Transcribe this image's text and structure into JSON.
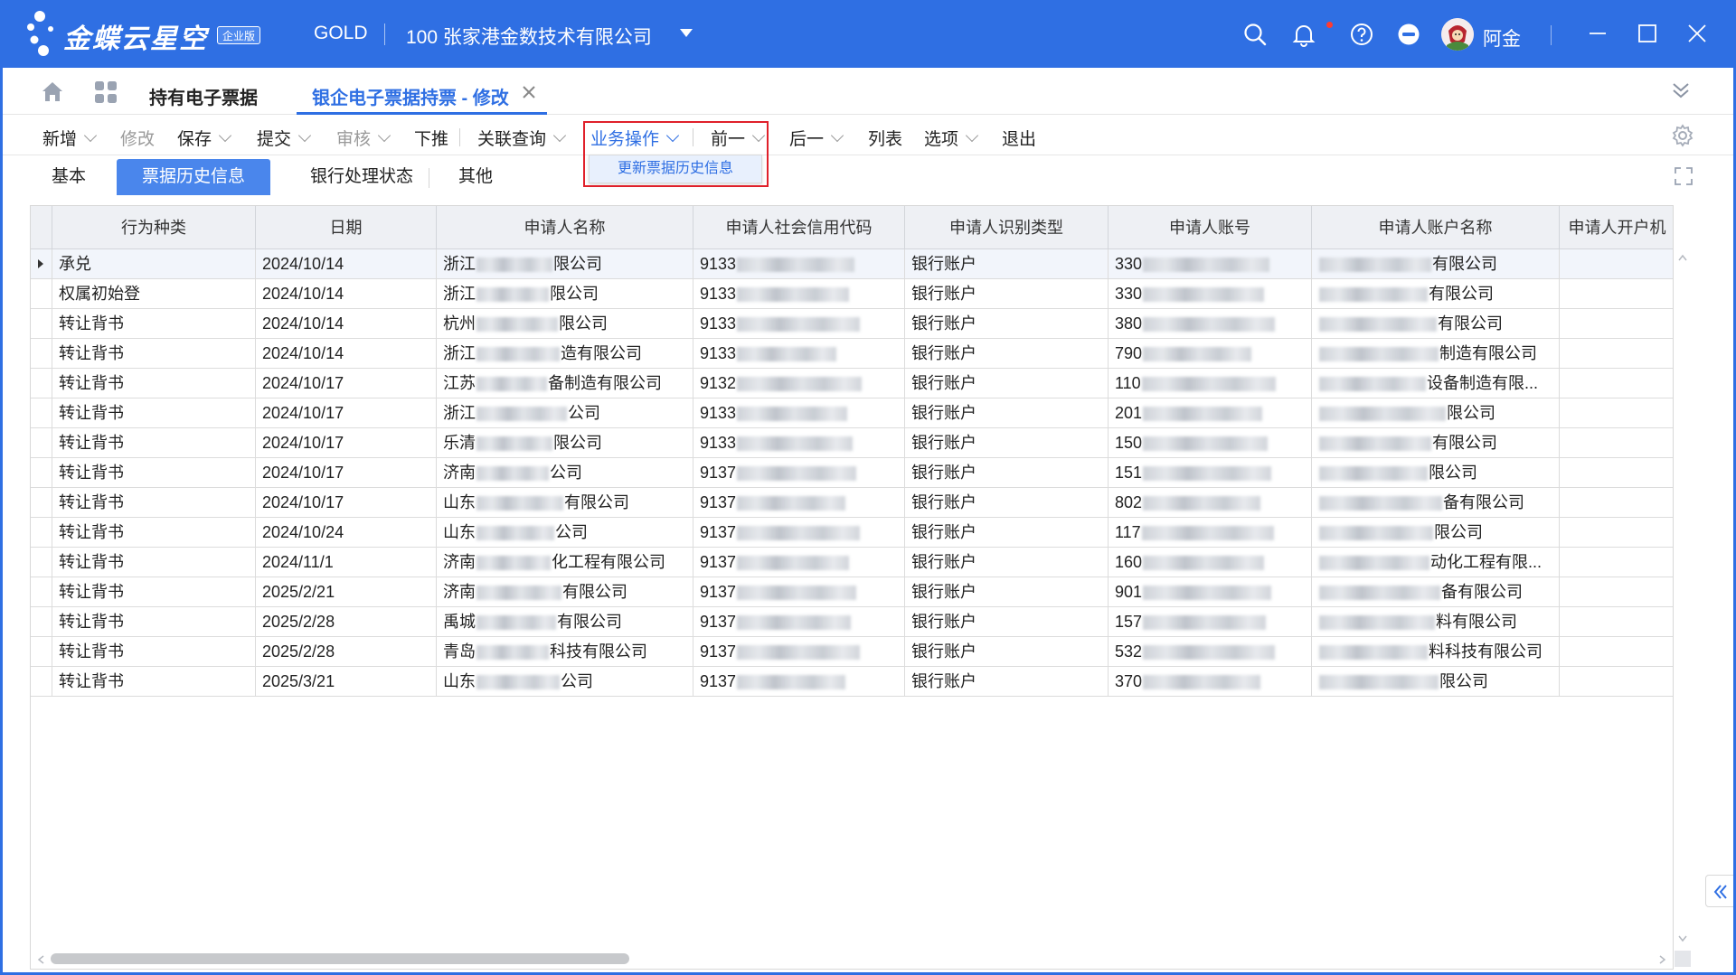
{
  "app": {
    "logo_text": "金蝶云星空",
    "logo_badge": "企业版",
    "org": "GOLD",
    "company": "100 张家港金数技术有限公司",
    "user": "阿金",
    "colors": {
      "brand": "#2f6fe3",
      "highlight_box": "#e0202a"
    },
    "icons": [
      "search-icon",
      "bell-icon",
      "help-icon",
      "status-icon",
      "avatar",
      "minimize-icon",
      "maximize-icon",
      "close-icon"
    ]
  },
  "tabs": {
    "home_icon": "home-icon",
    "apps_icon": "apps-grid-icon",
    "items": [
      {
        "label": "持有电子票据"
      },
      {
        "label": "银企电子票据持票 - 修改"
      }
    ]
  },
  "toolbar": {
    "new": "新增",
    "modify": "修改",
    "save": "保存",
    "submit": "提交",
    "audit": "审核",
    "push_down": "下推",
    "related_query": "关联查询",
    "business_ops": "业务操作",
    "previous": "前一",
    "next": "后一",
    "list": "列表",
    "options": "选项",
    "exit": "退出",
    "business_ops_menu": [
      "更新票据历史信息"
    ]
  },
  "subtabs": [
    "基本",
    "票据历史信息",
    "银行处理状态",
    "其他"
  ],
  "grid": {
    "columns": [
      "行为种类",
      "日期",
      "申请人名称",
      "申请人社会信用代码",
      "申请人识别类型",
      "申请人账号",
      "申请人账户名称",
      "申请人开户机"
    ],
    "rows": [
      {
        "action": "承兑",
        "date": "2024/10/14",
        "name_pre": "浙江",
        "name_suf": "限公司",
        "code_pre": "9133",
        "type": "银行账户",
        "acct_pre": "330",
        "acctname_suf": "有限公司"
      },
      {
        "action": "权属初始登",
        "date": "2024/10/14",
        "name_pre": "浙江",
        "name_suf": "限公司",
        "code_pre": "9133",
        "type": "银行账户",
        "acct_pre": "330",
        "acctname_suf": "有限公司"
      },
      {
        "action": "转让背书",
        "date": "2024/10/14",
        "name_pre": "杭州",
        "name_suf": "限公司",
        "code_pre": "9133",
        "type": "银行账户",
        "acct_pre": "380",
        "acctname_suf": "有限公司"
      },
      {
        "action": "转让背书",
        "date": "2024/10/14",
        "name_pre": "浙江",
        "name_suf": "造有限公司",
        "code_pre": "9133",
        "type": "银行账户",
        "acct_pre": "790",
        "acctname_suf": "制造有限公司"
      },
      {
        "action": "转让背书",
        "date": "2024/10/17",
        "name_pre": "江苏",
        "name_suf": "备制造有限公司",
        "code_pre": "9132",
        "type": "银行账户",
        "acct_pre": "110",
        "acctname_suf": "设备制造有限..."
      },
      {
        "action": "转让背书",
        "date": "2024/10/17",
        "name_pre": "浙江",
        "name_suf": "公司",
        "code_pre": "9133",
        "type": "银行账户",
        "acct_pre": "201",
        "acctname_suf": "限公司"
      },
      {
        "action": "转让背书",
        "date": "2024/10/17",
        "name_pre": "乐清",
        "name_suf": "限公司",
        "code_pre": "9133",
        "type": "银行账户",
        "acct_pre": "150",
        "acctname_suf": "有限公司"
      },
      {
        "action": "转让背书",
        "date": "2024/10/17",
        "name_pre": "济南",
        "name_suf": "公司",
        "code_pre": "9137",
        "type": "银行账户",
        "acct_pre": "151",
        "acctname_suf": "限公司"
      },
      {
        "action": "转让背书",
        "date": "2024/10/17",
        "name_pre": "山东",
        "name_suf": "有限公司",
        "code_pre": "9137",
        "type": "银行账户",
        "acct_pre": "802",
        "acctname_suf": "备有限公司"
      },
      {
        "action": "转让背书",
        "date": "2024/10/24",
        "name_pre": "山东",
        "name_suf": "公司",
        "code_pre": "9137",
        "type": "银行账户",
        "acct_pre": "117",
        "acctname_suf": "限公司"
      },
      {
        "action": "转让背书",
        "date": "2024/11/1",
        "name_pre": "济南",
        "name_suf": "化工程有限公司",
        "code_pre": "9137",
        "type": "银行账户",
        "acct_pre": "160",
        "acctname_suf": "动化工程有限..."
      },
      {
        "action": "转让背书",
        "date": "2025/2/21",
        "name_pre": "济南",
        "name_suf": "有限公司",
        "code_pre": "9137",
        "type": "银行账户",
        "acct_pre": "901",
        "acctname_suf": "备有限公司"
      },
      {
        "action": "转让背书",
        "date": "2025/2/28",
        "name_pre": "禹城",
        "name_suf": "有限公司",
        "code_pre": "9137",
        "type": "银行账户",
        "acct_pre": "157",
        "acctname_suf": "料有限公司"
      },
      {
        "action": "转让背书",
        "date": "2025/2/28",
        "name_pre": "青岛",
        "name_suf": "科技有限公司",
        "code_pre": "9137",
        "type": "银行账户",
        "acct_pre": "532",
        "acctname_suf": "料科技有限公司"
      },
      {
        "action": "转让背书",
        "date": "2025/3/21",
        "name_pre": "山东",
        "name_suf": "公司",
        "code_pre": "9137",
        "type": "银行账户",
        "acct_pre": "370",
        "acctname_suf": "限公司"
      }
    ]
  }
}
